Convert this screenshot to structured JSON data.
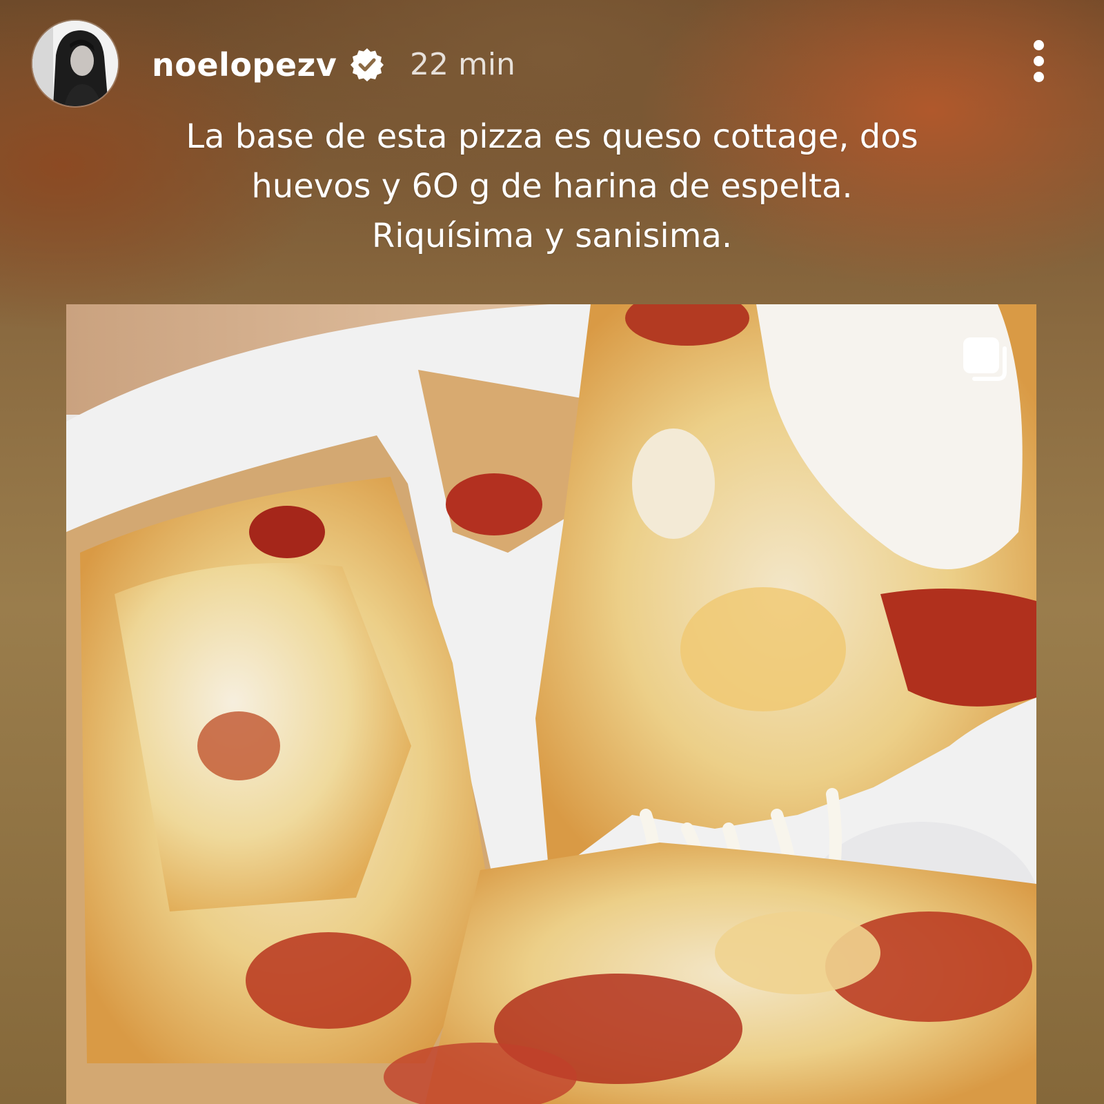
{
  "header": {
    "username": "noelopezv",
    "verified": true,
    "time_ago": "22 min",
    "avatar_icon": "profile-photo",
    "more_icon": "more-vertical-icon"
  },
  "caption": {
    "lines": [
      "La base de esta pizza es queso cottage, dos",
      "huevos y 6O g de harina de espelta.",
      "Riquísima y sanisima."
    ]
  },
  "post": {
    "image_subject": "pizza-slices-on-plate",
    "multi_image_icon": "carousel-icon"
  },
  "colors": {
    "text": "#ffffff",
    "verified_badge": "#ffffff"
  }
}
